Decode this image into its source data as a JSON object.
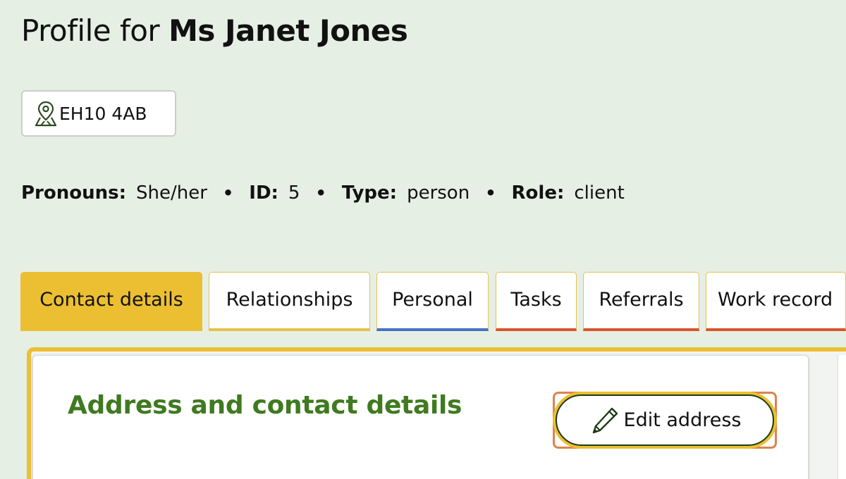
{
  "header": {
    "title_prefix": "Profile for",
    "person_name": "Ms Janet Jones"
  },
  "location": {
    "postcode": "EH10 4AB",
    "icon": "map-pin-icon"
  },
  "meta": {
    "pronouns_label": "Pronouns:",
    "pronouns_value": "She/her",
    "id_label": "ID:",
    "id_value": "5",
    "type_label": "Type:",
    "type_value": "person",
    "role_label": "Role:",
    "role_value": "client",
    "separator": "•"
  },
  "tabs": [
    {
      "label": "Contact details",
      "active": true,
      "underline_color": "#ecbf33"
    },
    {
      "label": "Relationships",
      "active": false,
      "underline_color": "#e8c04a"
    },
    {
      "label": "Personal",
      "active": false,
      "underline_color": "#4a72c4"
    },
    {
      "label": "Tasks",
      "active": false,
      "underline_color": "#d9532b"
    },
    {
      "label": "Referrals",
      "active": false,
      "underline_color": "#d9532b"
    },
    {
      "label": "Work record",
      "active": false,
      "underline_color": "#d9532b"
    }
  ],
  "section": {
    "title": "Address and contact details",
    "edit_button_label": "Edit address",
    "edit_button_icon": "pencil-icon"
  },
  "colors": {
    "page_background": "#e6efe3",
    "accent_yellow": "#ecbf33",
    "section_title_green": "#3f7a20",
    "focus_orange": "#e0824b"
  }
}
